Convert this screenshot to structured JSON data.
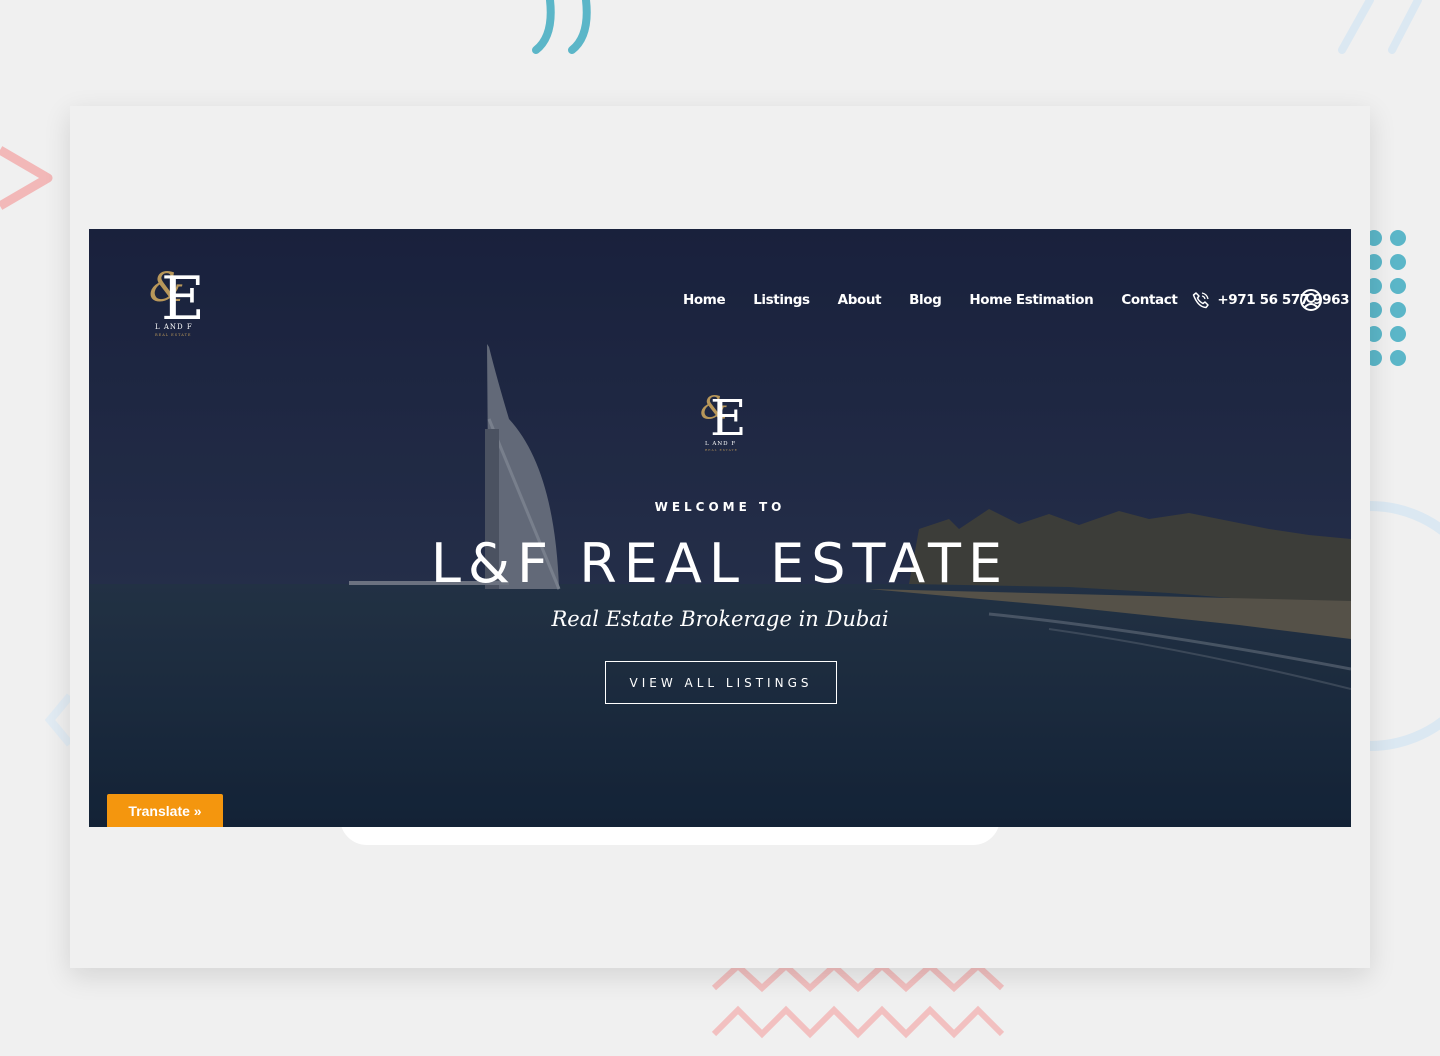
{
  "nav": {
    "items": [
      "Home",
      "Listings",
      "About",
      "Blog",
      "Home Estimation",
      "Contact"
    ],
    "phone": "+971 56 577 9963",
    "phone_icon": "phone-icon",
    "user_icon": "user-account-icon"
  },
  "logo": {
    "monogram": "&LF",
    "name": "L AND F",
    "tagline": "REAL ESTATE"
  },
  "hero": {
    "welcome": "WELCOME TO",
    "title": "L&F REAL ESTATE",
    "subtitle": "Real Estate Brokerage in Dubai",
    "cta": "VIEW ALL LISTINGS"
  },
  "translate": {
    "label": "Translate »"
  },
  "colors": {
    "page_bg": "#f0f0f0",
    "accent_gold": "#b8975a",
    "translate_orange": "#f4960e",
    "deco_teal": "#5bb6c8",
    "deco_pink": "#f2a6a6"
  }
}
